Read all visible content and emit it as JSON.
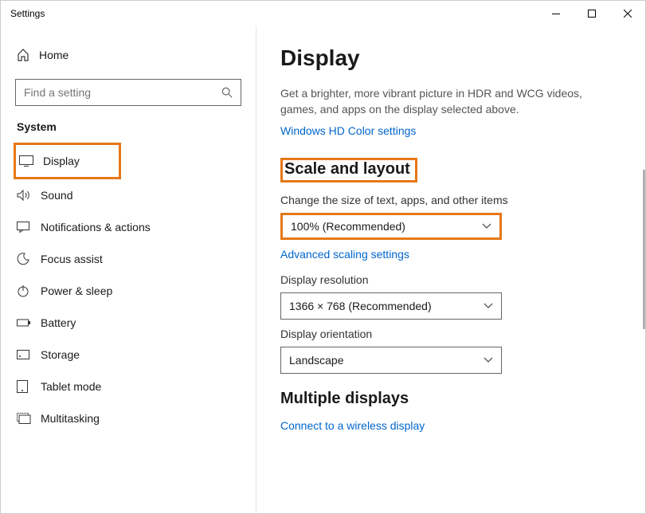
{
  "window": {
    "title": "Settings"
  },
  "sidebar": {
    "home": "Home",
    "search_placeholder": "Find a setting",
    "section": "System",
    "items": [
      {
        "label": "Display"
      },
      {
        "label": "Sound"
      },
      {
        "label": "Notifications & actions"
      },
      {
        "label": "Focus assist"
      },
      {
        "label": "Power & sleep"
      },
      {
        "label": "Battery"
      },
      {
        "label": "Storage"
      },
      {
        "label": "Tablet mode"
      },
      {
        "label": "Multitasking"
      }
    ]
  },
  "main": {
    "title": "Display",
    "hdr_desc": "Get a brighter, more vibrant picture in HDR and WCG videos, games, and apps on the display selected above.",
    "hdr_link": "Windows HD Color settings",
    "scale_heading": "Scale and layout",
    "scale_label": "Change the size of text, apps, and other items",
    "scale_value": "100% (Recommended)",
    "scale_link": "Advanced scaling settings",
    "res_label": "Display resolution",
    "res_value": "1366 × 768 (Recommended)",
    "orient_label": "Display orientation",
    "orient_value": "Landscape",
    "multi_heading": "Multiple displays",
    "multi_link": "Connect to a wireless display"
  }
}
